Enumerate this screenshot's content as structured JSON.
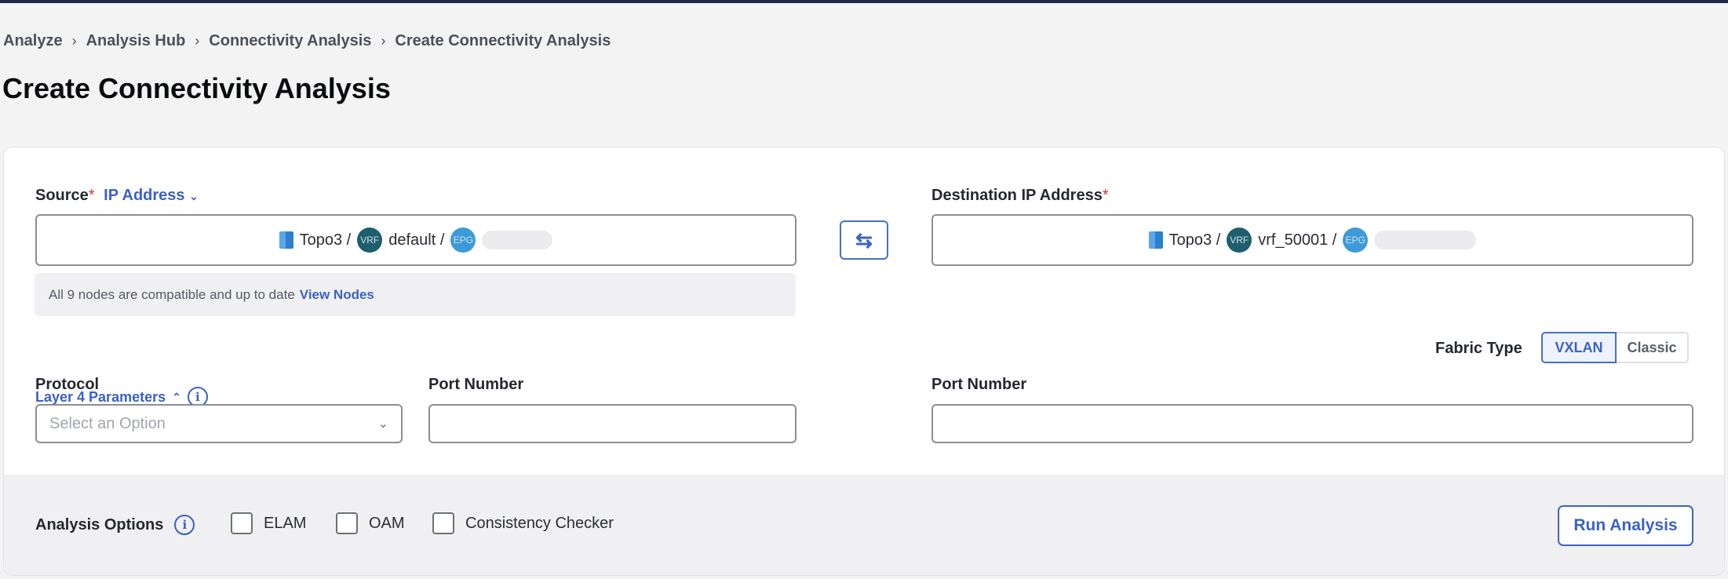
{
  "breadcrumb": [
    "Analyze",
    "Analysis Hub",
    "Connectivity Analysis",
    "Create Connectivity Analysis"
  ],
  "title": "Create Connectivity Analysis",
  "source": {
    "label": "Source",
    "required": "*",
    "type": "IP Address",
    "topo": "Topo3 /",
    "vrf_badge": "VRF",
    "vrf": "default /",
    "epg_badge": "EPG"
  },
  "destination": {
    "label": "Destination IP Address",
    "required": "*",
    "topo": "Topo3 /",
    "vrf_badge": "VRF",
    "vrf": "vrf_50001 /",
    "epg_badge": "EPG"
  },
  "notice": {
    "text": "All 9 nodes are compatible and up to date",
    "link": "View Nodes"
  },
  "layer4": {
    "label": "Layer 4 Parameters",
    "info": "i"
  },
  "fabric": {
    "label": "Fabric Type",
    "options": [
      "VXLAN",
      "Classic"
    ],
    "selected": "VXLAN"
  },
  "protocol": {
    "label": "Protocol",
    "placeholder": "Select an Option"
  },
  "src_port": {
    "label": "Port Number",
    "value": ""
  },
  "dst_port": {
    "label": "Port Number",
    "value": ""
  },
  "analysis_options": {
    "label": "Analysis Options",
    "info": "i",
    "checkboxes": [
      {
        "label": "ELAM",
        "checked": false
      },
      {
        "label": "OAM",
        "checked": false
      },
      {
        "label": "Consistency Checker",
        "checked": false
      }
    ]
  },
  "run_button": "Run Analysis",
  "colors": {
    "accent": "#3b62c2",
    "topbar": "#1e2b48",
    "required": "#c3393b"
  }
}
